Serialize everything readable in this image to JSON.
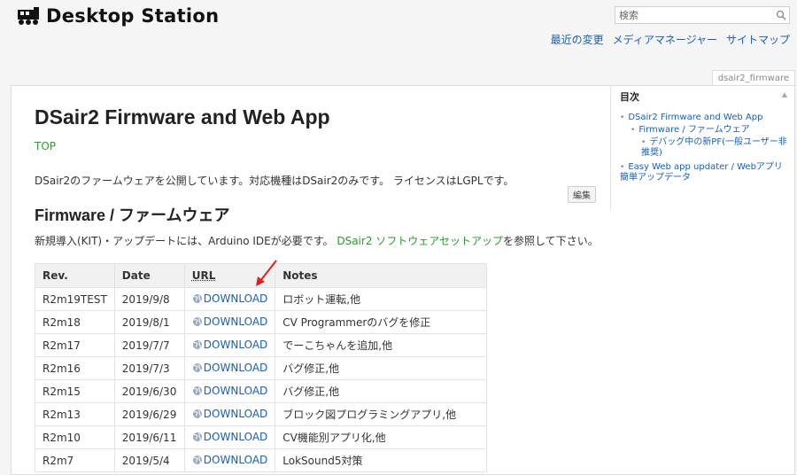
{
  "header": {
    "site_name": "Desktop Station",
    "logo_icon": "train-icon",
    "search": {
      "placeholder": "検索",
      "icon": "search-icon"
    },
    "nav": [
      {
        "label": "最近の変更"
      },
      {
        "label": "メディアマネージャー"
      },
      {
        "label": "サイトマップ"
      }
    ]
  },
  "page": {
    "tab_label": "dsair2_firmware",
    "title": "DSair2 Firmware and Web App",
    "top_link": "TOP",
    "intro": "DSair2のファームウェアを公開しています。対応機種はDSair2のみです。 ライセンスはLGPLです。",
    "edit_label": "編集",
    "section_title": "Firmware / ファームウェア",
    "section_desc_prefix": "新規導入(KIT)・アップデートには、Arduino IDEが必要です。 ",
    "section_desc_link": "DSair2 ソフトウェアセットアップ",
    "section_desc_suffix": "を参照して下さい。"
  },
  "toc": {
    "title": "目次",
    "toggle": "▲",
    "items": [
      {
        "label": "DSair2 Firmware and Web App",
        "level": 1
      },
      {
        "label": "Firmware / ファームウェア",
        "level": 2
      },
      {
        "label": "デバッグ中の新PF(一般ユーザー非推奨)",
        "level": 3
      },
      {
        "label": "Easy Web app updater / Webアプリ簡単アップデータ",
        "level": 1
      }
    ]
  },
  "table": {
    "headers": {
      "rev": "Rev.",
      "date": "Date",
      "url": "URL",
      "notes": "Notes"
    },
    "rows": [
      {
        "rev": "R2m19TEST",
        "date": "2019/9/8",
        "url": "DOWNLOAD",
        "notes": "ロボット運転,他"
      },
      {
        "rev": "R2m18",
        "date": "2019/8/1",
        "url": "DOWNLOAD",
        "notes": "CV Programmerのバグを修正"
      },
      {
        "rev": "R2m17",
        "date": "2019/7/7",
        "url": "DOWNLOAD",
        "notes": "でーこちゃんを追加,他"
      },
      {
        "rev": "R2m16",
        "date": "2019/7/3",
        "url": "DOWNLOAD",
        "notes": "バグ修正,他"
      },
      {
        "rev": "R2m15",
        "date": "2019/6/30",
        "url": "DOWNLOAD",
        "notes": "バグ修正,他"
      },
      {
        "rev": "R2m13",
        "date": "2019/6/29",
        "url": "DOWNLOAD",
        "notes": "ブロック図プログラミングアプリ,他"
      },
      {
        "rev": "R2m10",
        "date": "2019/6/11",
        "url": "DOWNLOAD",
        "notes": "CV機能別アプリ化,他"
      },
      {
        "rev": "R2m7",
        "date": "2019/5/4",
        "url": "DOWNLOAD",
        "notes": "LokSound5対策"
      }
    ]
  },
  "colors": {
    "link": "#1a5fb4",
    "green_link": "#2a9a2a",
    "annotation_arrow": "#e02020"
  }
}
